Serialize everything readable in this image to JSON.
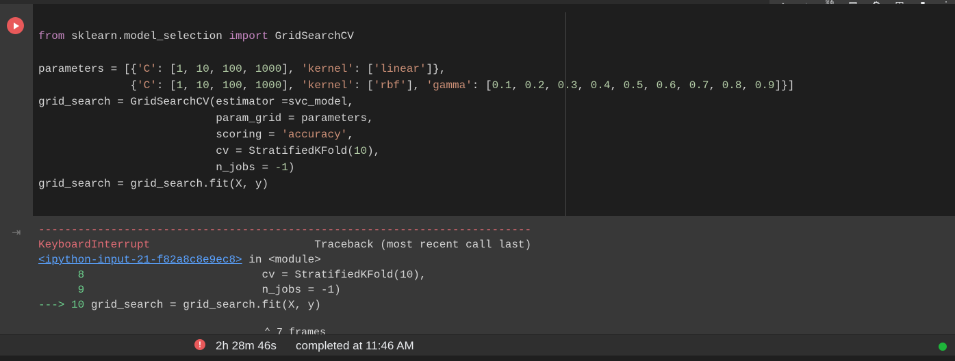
{
  "toolbar": {
    "icons": [
      "arrow-up-icon",
      "arrow-down-icon",
      "link-icon",
      "comment-icon",
      "settings-icon",
      "mirror-cell-icon",
      "delete-icon",
      "more-icon"
    ]
  },
  "code_cell": {
    "run_button": "run-cell",
    "lines": [
      "from sklearn.model_selection import GridSearchCV",
      "",
      "parameters = [{'C': [1, 10, 100, 1000], 'kernel': ['linear']},",
      "              {'C': [1, 10, 100, 1000], 'kernel': ['rbf'], 'gamma': [0.1, 0.2, 0.3, 0.4, 0.5, 0.6, 0.7, 0.8, 0.9]}]",
      "grid_search = GridSearchCV(estimator =svc_model,",
      "                           param_grid = parameters,",
      "                           scoring = 'accuracy',",
      "                           cv = StratifiedKFold(10),",
      "                           n_jobs = -1)",
      "grid_search = grid_search.fit(X, y)"
    ]
  },
  "output": {
    "separator": "---------------------------------------------------------------------------",
    "error_name": "KeyboardInterrupt",
    "traceback_header": "Traceback (most recent call last)",
    "input_link": "<ipython-input-21-f82a8c8e9ec8>",
    "in_module": " in <module>",
    "line8_no": "      8",
    "line8_code": "                           cv = StratifiedKFold(10),",
    "line9_no": "      9",
    "line9_code": "                           n_jobs = -1)",
    "arrow": "---> 10",
    "line10_code": " grid_search = grid_search.fit(X, y)",
    "frames_label": "7 frames"
  },
  "status": {
    "duration": "2h 28m 46s",
    "completed": "completed at 11:46 AM",
    "colors": {
      "error": "#e8595a",
      "connected": "#1eb53a"
    }
  }
}
